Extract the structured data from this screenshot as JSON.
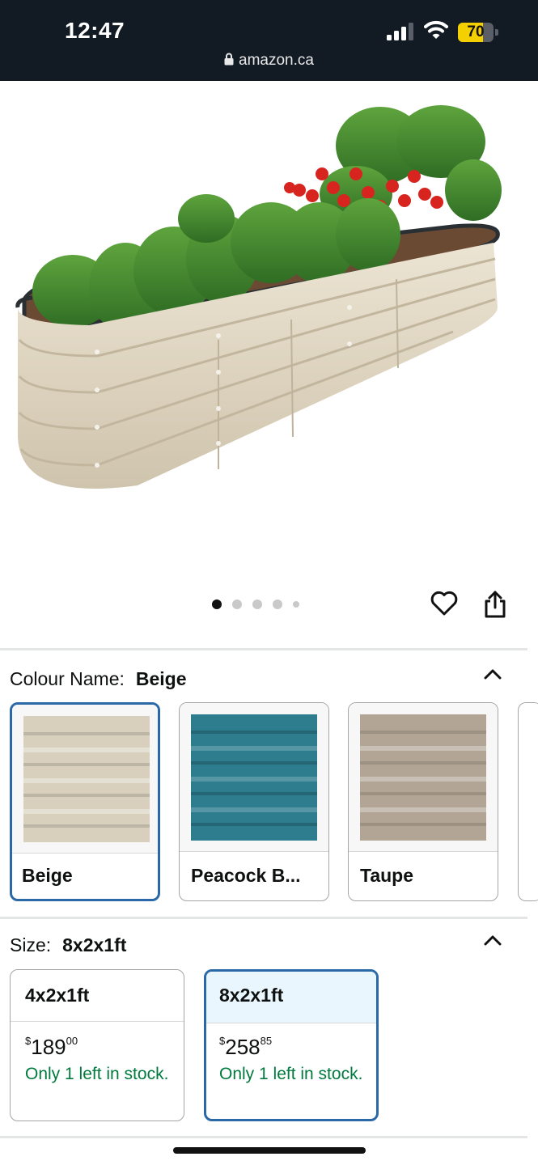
{
  "status_bar": {
    "time": "12:47",
    "battery_level": 70,
    "battery_text": "70",
    "url": "amazon.ca",
    "icons": [
      "signal-icon",
      "wifi-icon",
      "battery-icon",
      "lock-icon"
    ]
  },
  "gallery": {
    "image_count": 5,
    "active_index": 0,
    "icons": [
      "heart-icon",
      "share-icon"
    ]
  },
  "colour": {
    "label": "Colour Name:",
    "selected": "Beige",
    "options": [
      {
        "label": "Beige",
        "color": "#d8cfbd"
      },
      {
        "label": "Peacock B...",
        "color": "#2e7d8f"
      },
      {
        "label": "Taupe",
        "color": "#b2a596"
      }
    ]
  },
  "size": {
    "label": "Size:",
    "selected": "8x2x1ft",
    "options": [
      {
        "title": "4x2x1ft",
        "currency": "$",
        "dollars": "189",
        "cents": "00",
        "stock": "Only 1 left in stock."
      },
      {
        "title": "8x2x1ft",
        "currency": "$",
        "dollars": "258",
        "cents": "85",
        "stock": "Only 1 left in stock."
      }
    ]
  },
  "colors": {
    "status_bar_bg": "#121a24",
    "selected_border": "#2a68a8",
    "stock_green": "#007a3d",
    "battery_yellow": "#f5d000"
  }
}
